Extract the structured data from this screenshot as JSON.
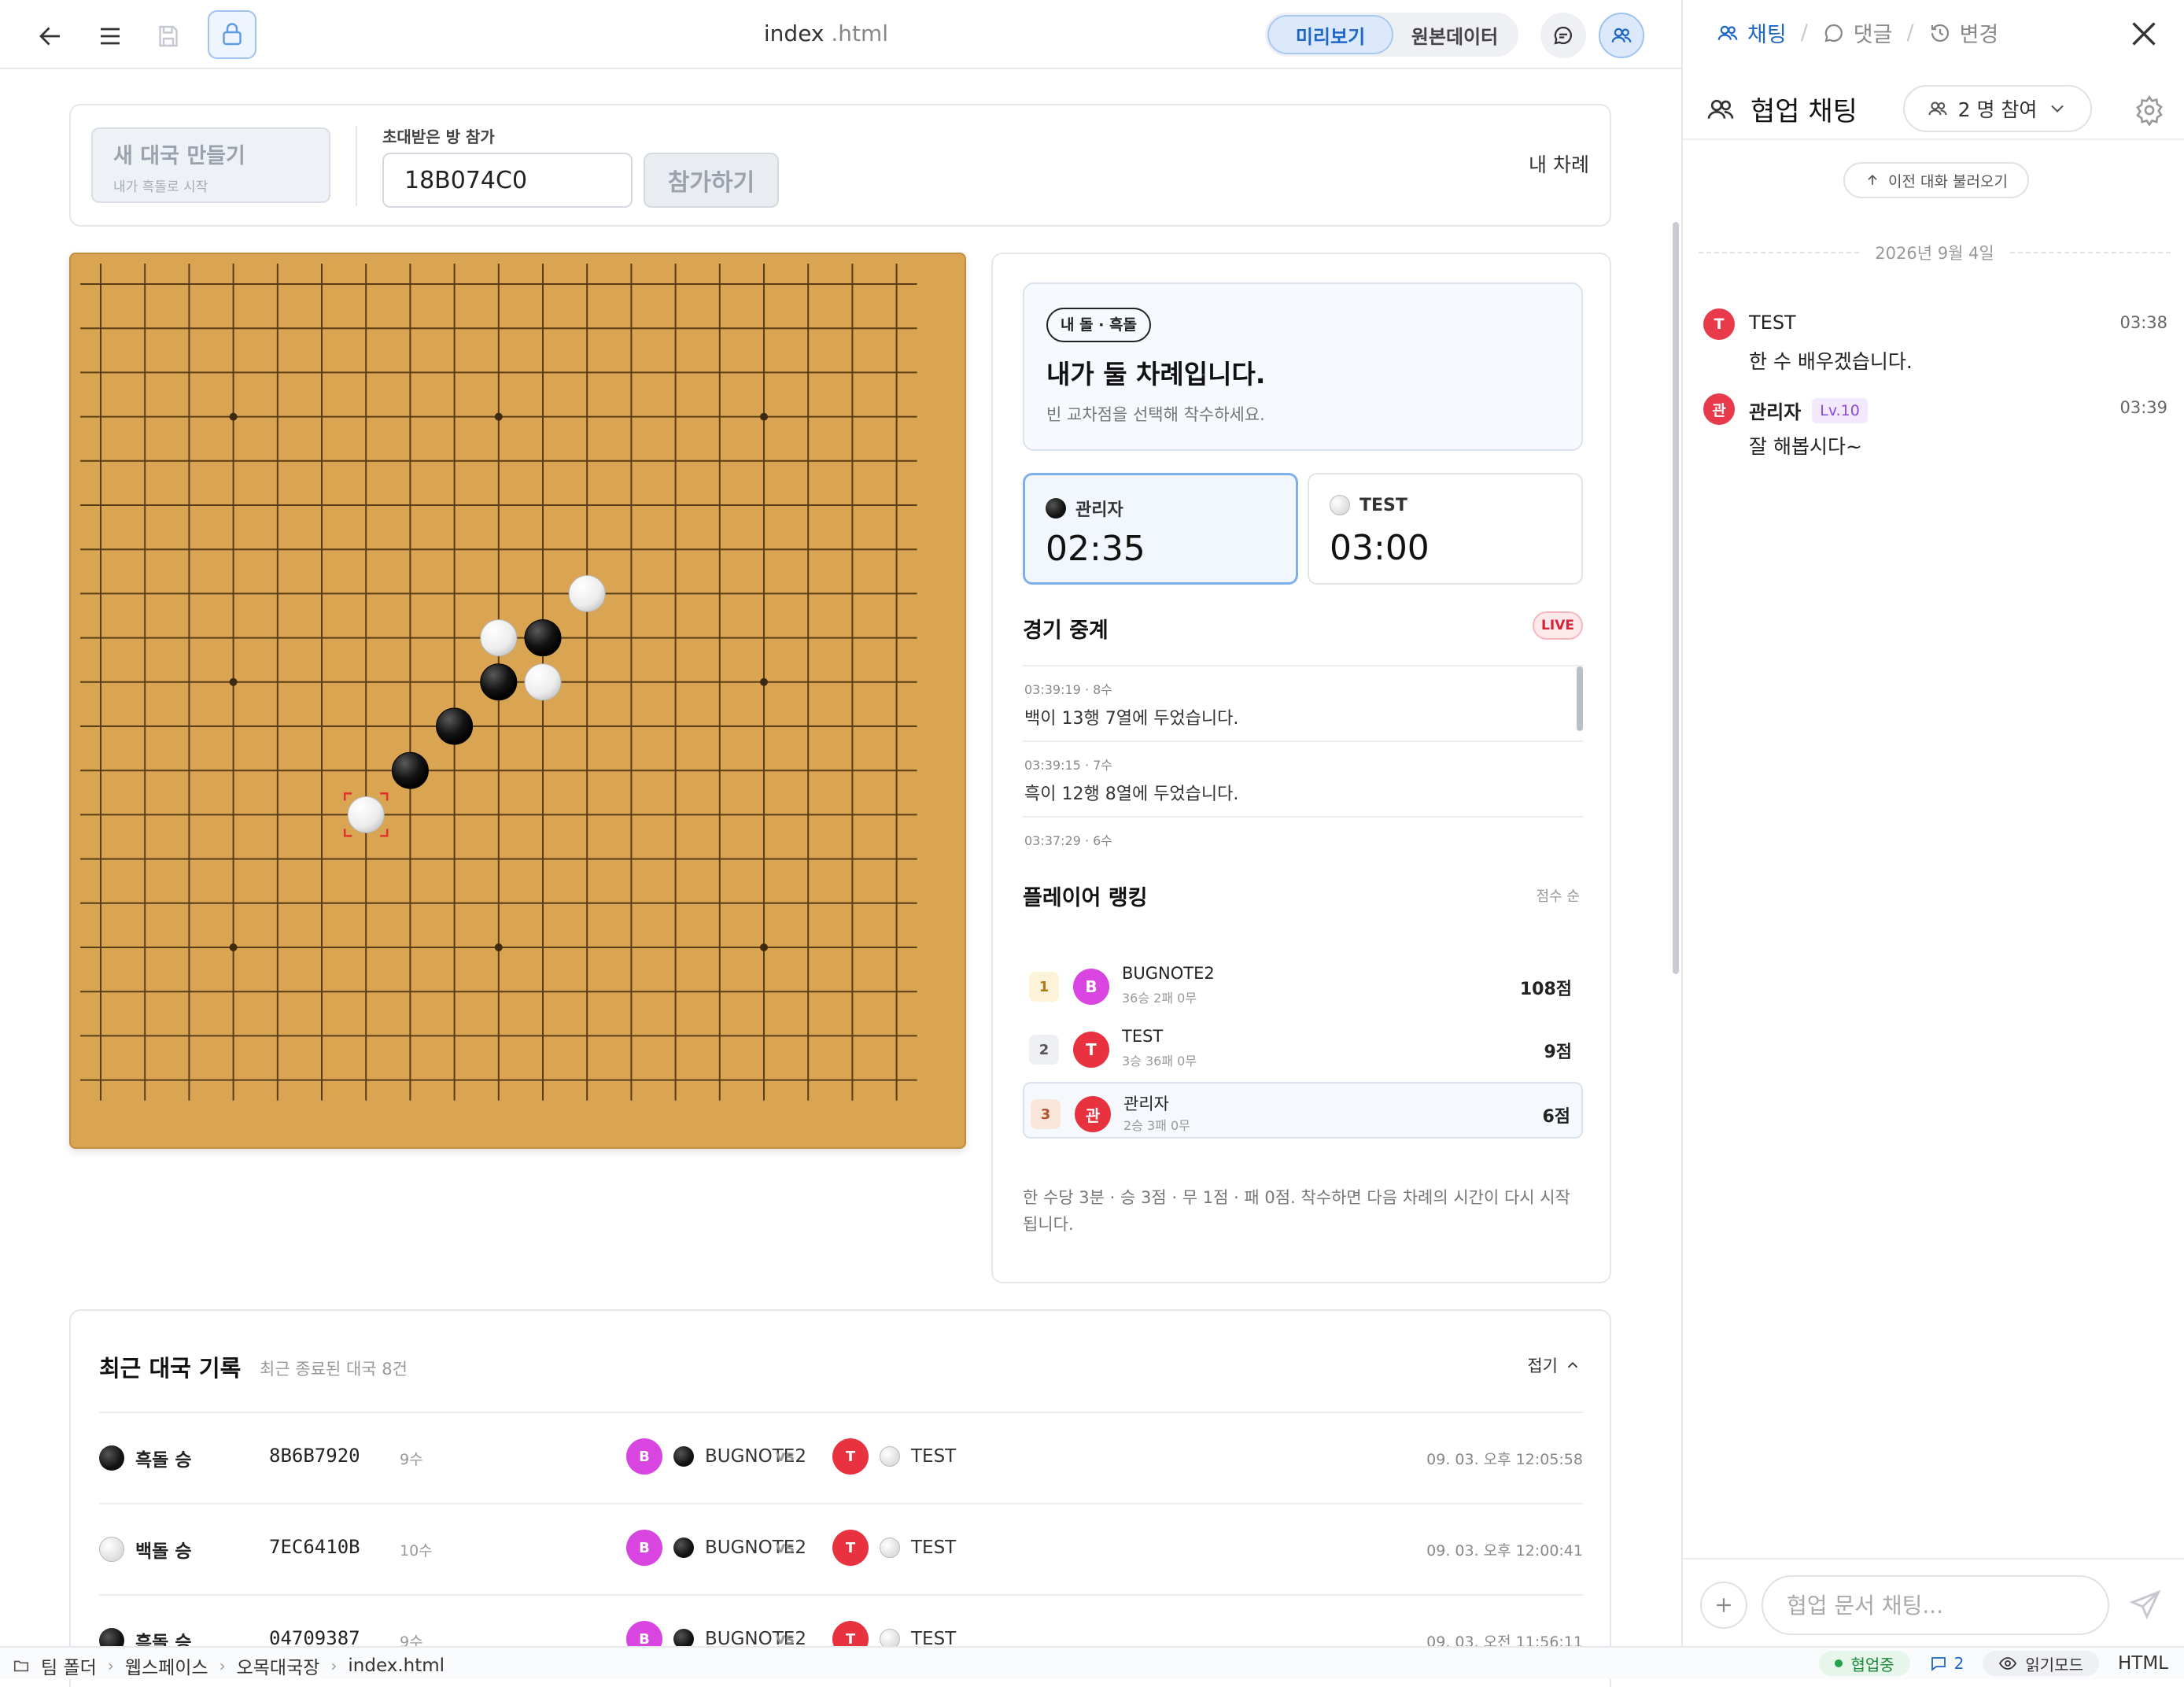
{
  "toolbar": {
    "file_name": "index",
    "file_ext": ".html",
    "preview_label": "미리보기",
    "source_label": "원본데이터"
  },
  "create": {
    "new_game_title": "새 대국 만들기",
    "new_game_sub": "내가 흑돌로 시작",
    "invite_label": "초대받은 방 참가",
    "room_code": "18B074C0",
    "join_label": "참가하기",
    "turn_status": "내 차례"
  },
  "board": {
    "size": 19,
    "star_points": [
      [
        3,
        3
      ],
      [
        3,
        9
      ],
      [
        3,
        15
      ],
      [
        9,
        3
      ],
      [
        9,
        9
      ],
      [
        9,
        15
      ],
      [
        15,
        3
      ],
      [
        15,
        9
      ],
      [
        15,
        15
      ]
    ],
    "stones": [
      {
        "row": 7,
        "col": 11,
        "color": "white"
      },
      {
        "row": 8,
        "col": 9,
        "color": "white"
      },
      {
        "row": 8,
        "col": 10,
        "color": "black"
      },
      {
        "row": 9,
        "col": 9,
        "color": "black"
      },
      {
        "row": 9,
        "col": 10,
        "color": "white"
      },
      {
        "row": 10,
        "col": 8,
        "color": "black"
      },
      {
        "row": 11,
        "col": 7,
        "color": "black"
      },
      {
        "row": 12,
        "col": 6,
        "color": "white",
        "last": true
      }
    ]
  },
  "turn": {
    "stone_label": "내 돌 · 흑돌",
    "title": "내가 둘 차례입니다.",
    "subtitle": "빈 교차점을 선택해 착수하세요."
  },
  "timers": [
    {
      "name": "관리자",
      "time": "02:35",
      "stone": "black",
      "active": true
    },
    {
      "name": "TEST",
      "time": "03:00",
      "stone": "white",
      "active": false
    }
  ],
  "broadcast": {
    "title": "경기 중계",
    "live": "LIVE",
    "logs": [
      {
        "meta": "03:39:19 · 8수",
        "text": "백이 13행 7열에 두었습니다."
      },
      {
        "meta": "03:39:15 · 7수",
        "text": "흑이 12행 8열에 두었습니다."
      },
      {
        "meta": "03:37:29 · 6수",
        "text": ""
      }
    ]
  },
  "ranking": {
    "title": "플레이어 랭킹",
    "sort": "점수 순",
    "rows": [
      {
        "rank": "1",
        "initial": "B",
        "name": "BUGNOTE2",
        "record": "36승 2패 0무",
        "score": "108점",
        "avatar_color": "#d845e0",
        "rank_bg": "#fdf3d8",
        "rank_fg": "#b07a12",
        "me": false
      },
      {
        "rank": "2",
        "initial": "T",
        "name": "TEST",
        "record": "3승 36패 0무",
        "score": "9점",
        "avatar_color": "#e8323f",
        "rank_bg": "#eef0f3",
        "rank_fg": "#555",
        "me": false
      },
      {
        "rank": "3",
        "initial": "관",
        "name": "관리자",
        "record": "2승 3패 0무",
        "score": "6점",
        "avatar_color": "#e8323f",
        "rank_bg": "#fbe6dc",
        "rank_fg": "#b5522b",
        "me": true
      }
    ]
  },
  "rules_note": "한 수당 3분 · 승 3점 · 무 1점 · 패 0점. 착수하면 다음 차례의 시간이 다시 시작됩니다.",
  "history": {
    "title": "최근 대국 기록",
    "subtitle": "최근 종료된 대국 8건",
    "fold": "접기",
    "vs": "vs",
    "rows": [
      {
        "result": "흑돌 승",
        "stone": "black",
        "code": "8B6B7920",
        "moves": "9수",
        "p1_initial": "B",
        "p1": "BUGNOTE2",
        "p2_initial": "T",
        "p2": "TEST",
        "date": "09. 03. 오후 12:05:58"
      },
      {
        "result": "백돌 승",
        "stone": "white",
        "code": "7EC6410B",
        "moves": "10수",
        "p1_initial": "B",
        "p1": "BUGNOTE2",
        "p2_initial": "T",
        "p2": "TEST",
        "date": "09. 03. 오후 12:00:41"
      },
      {
        "result": "흑돌 승",
        "stone": "black",
        "code": "04709387",
        "moves": "9수",
        "p1_initial": "B",
        "p1": "BUGNOTE2",
        "p2_initial": "T",
        "p2": "TEST",
        "date": "09. 03. 오전 11:56:11"
      }
    ]
  },
  "rpanel": {
    "tab_chat": "채팅",
    "tab_comments": "댓글",
    "tab_changes": "변경",
    "title": "협업 채팅",
    "participants": "2 명 참여",
    "load_prev": "이전 대화 불러오기",
    "date": "2026년 9월 4일",
    "messages": [
      {
        "initial": "T",
        "name": "TEST",
        "level": "",
        "time": "03:38",
        "text": "한 수 배우겠습니다."
      },
      {
        "initial": "관",
        "name": "관리자",
        "level": "Lv.10",
        "time": "03:39",
        "text": "잘 해봅시다~"
      }
    ],
    "input_placeholder": "협업 문서 채팅..."
  },
  "status": {
    "crumbs": [
      "팀 폴더",
      "웹스페이스",
      "오목대국장",
      "index.html"
    ],
    "collab": "협업중",
    "comments": "2",
    "read_mode": "읽기모드",
    "file_type": "HTML"
  },
  "colors": {
    "accent": "#1f66c9",
    "board": "#d9a552",
    "live": "#d3233a",
    "avatar_b": "#d845e0",
    "avatar_t": "#e8323f"
  }
}
